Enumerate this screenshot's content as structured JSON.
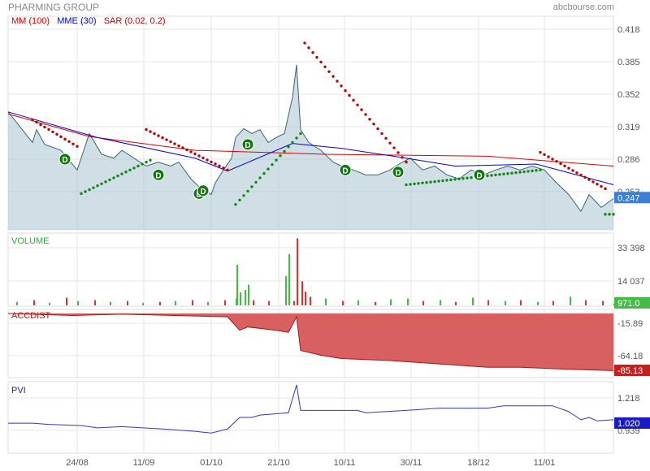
{
  "header": {
    "title": "PHARMING GROUP",
    "source": "abcbourse.com"
  },
  "legend": {
    "mm": "MM (100)",
    "mme": "MME (30)",
    "sar": "SAR (0.02, 0.2)"
  },
  "colors": {
    "price_fill": "#a9c4cf",
    "price_line": "#3b6474",
    "mm": "#e00000",
    "mme": "#0000e0",
    "sar": "#c00000",
    "sar_up": "#118811",
    "volume_up": "#44bb44",
    "volume_down": "#e03030",
    "accdist": "#d96060",
    "pvi": "#3333cc"
  },
  "chart_data": [
    {
      "type": "area",
      "name": "price",
      "title": "PHARMING GROUP",
      "ylim": [
        0.22,
        0.42
      ],
      "y_ticks": [
        "0.418",
        "0.385",
        "0.352",
        "0.319",
        "0.286",
        "0.253"
      ],
      "last_value": "0.247",
      "x_ticks": [
        "24/08",
        "11/09",
        "01/10",
        "21/10",
        "10/11",
        "30/11",
        "18/12",
        "11/01"
      ],
      "x": [
        0,
        6,
        7,
        9,
        13,
        17,
        20,
        23,
        26,
        28,
        31,
        34,
        37,
        40,
        42,
        45,
        47,
        50,
        51,
        53,
        55,
        56,
        58,
        60,
        62,
        64,
        66,
        68,
        70,
        71,
        72,
        74,
        77,
        80,
        82,
        85,
        88,
        91,
        94,
        97,
        99,
        102,
        105,
        108,
        111,
        114,
        117,
        120,
        123,
        126,
        129,
        132,
        135,
        138,
        141,
        143,
        146,
        149
      ],
      "values": [
        0.334,
        0.303,
        0.316,
        0.301,
        0.295,
        0.275,
        0.312,
        0.291,
        0.287,
        0.295,
        0.287,
        0.279,
        0.283,
        0.279,
        0.283,
        0.266,
        0.258,
        0.25,
        0.262,
        0.275,
        0.287,
        0.308,
        0.317,
        0.312,
        0.316,
        0.303,
        0.308,
        0.312,
        0.349,
        0.382,
        0.316,
        0.303,
        0.295,
        0.283,
        0.279,
        0.275,
        0.27,
        0.27,
        0.275,
        0.283,
        0.287,
        0.275,
        0.279,
        0.27,
        0.266,
        0.275,
        0.27,
        0.275,
        0.279,
        0.275,
        0.279,
        0.275,
        0.262,
        0.25,
        0.233,
        0.25,
        0.237,
        0.246
      ],
      "mm": {
        "x": [
          0,
          20,
          46,
          78,
          118,
          149
        ],
        "values": [
          0.332,
          0.309,
          0.295,
          0.291,
          0.289,
          0.279
        ]
      },
      "mme": {
        "x": [
          0,
          22,
          46,
          54,
          70,
          82,
          98,
          110,
          130,
          149
        ],
        "values": [
          0.334,
          0.308,
          0.287,
          0.274,
          0.302,
          0.297,
          0.287,
          0.279,
          0.281,
          0.26
        ]
      },
      "sar": [
        {
          "x": [
            6,
            17
          ],
          "values": [
            0.326,
            0.299
          ],
          "pos": "above"
        },
        {
          "x": [
            18,
            35
          ],
          "values": [
            0.251,
            0.285
          ],
          "pos": "below"
        },
        {
          "x": [
            34,
            54
          ],
          "values": [
            0.316,
            0.275
          ],
          "pos": "above"
        },
        {
          "x": [
            56,
            72
          ],
          "values": [
            0.24,
            0.312
          ],
          "pos": "below"
        },
        {
          "x": [
            73,
            98
          ],
          "values": [
            0.404,
            0.283
          ],
          "pos": "above"
        },
        {
          "x": [
            98,
            131
          ],
          "values": [
            0.26,
            0.275
          ],
          "pos": "below"
        },
        {
          "x": [
            131,
            147
          ],
          "values": [
            0.293,
            0.256
          ],
          "pos": "above"
        },
        {
          "x": [
            147,
            149
          ],
          "values": [
            0.23,
            0.23
          ],
          "pos": "below"
        }
      ],
      "dividends": {
        "label": "D",
        "x": [
          14,
          37,
          47,
          48,
          59,
          83,
          96,
          116
        ],
        "values": [
          0.286,
          0.27,
          0.251,
          0.254,
          0.301,
          0.275,
          0.273,
          0.27
        ]
      }
    },
    {
      "type": "bar",
      "name": "volume",
      "title": "VOLUME",
      "y_ticks": [
        "33 398",
        "14 037"
      ],
      "last_value": "971.0",
      "x": [
        2,
        6,
        10,
        14,
        17,
        21,
        25,
        29,
        33,
        37,
        41,
        45,
        49,
        53,
        56,
        56,
        57,
        58,
        59,
        60,
        64,
        68,
        69,
        70,
        71,
        72,
        73,
        74,
        78,
        82,
        86,
        90,
        94,
        98,
        102,
        106,
        110,
        114,
        118,
        122,
        126,
        130,
        134,
        138,
        142,
        146,
        149
      ],
      "values": [
        2000,
        3000,
        1500,
        4500,
        2500,
        3000,
        2000,
        2500,
        1500,
        2000,
        2500,
        3000,
        2000,
        3000,
        4000,
        23600,
        7500,
        9000,
        12000,
        3000,
        2500,
        17000,
        29700,
        2500,
        39000,
        14000,
        8000,
        5000,
        4000,
        2500,
        3000,
        2000,
        3500,
        4000,
        2500,
        3000,
        2000,
        4500,
        3000,
        2500,
        3000,
        2000,
        2500,
        5000,
        3000,
        2500,
        971
      ],
      "dir": [
        "u",
        "d",
        "u",
        "d",
        "u",
        "d",
        "u",
        "d",
        "u",
        "d",
        "u",
        "d",
        "u",
        "d",
        "u",
        "u",
        "u",
        "u",
        "u",
        "d",
        "d",
        "u",
        "u",
        "d",
        "d",
        "d",
        "d",
        "d",
        "u",
        "d",
        "u",
        "d",
        "u",
        "u",
        "d",
        "u",
        "d",
        "u",
        "d",
        "u",
        "d",
        "u",
        "d",
        "u",
        "d",
        "d",
        "u"
      ]
    },
    {
      "type": "area",
      "name": "accdist",
      "title": "ACCDIST",
      "y_ticks": [
        "-15.89",
        "-64.18"
      ],
      "last_value": "-85.13",
      "x": [
        0,
        16,
        28,
        54,
        57,
        59,
        66,
        69,
        71,
        72,
        77,
        82,
        94,
        106,
        118,
        126,
        138,
        149
      ],
      "values": [
        0,
        -3,
        -1,
        -5,
        -25,
        -20,
        -25,
        -28,
        -5,
        -55,
        -62,
        -67,
        -70,
        -75,
        -80,
        -80,
        -83,
        -85
      ]
    },
    {
      "type": "line",
      "name": "pvi",
      "title": "PVI",
      "y_ticks": [
        "1.218",
        "0.939"
      ],
      "last_value": "1.020",
      "x": [
        0,
        6,
        10,
        18,
        22,
        28,
        38,
        46,
        50,
        54,
        57,
        60,
        62,
        69,
        71,
        72,
        86,
        88,
        98,
        106,
        118,
        122,
        128,
        134,
        138,
        141,
        143,
        145,
        149
      ],
      "values": [
        1.0,
        1.0,
        0.99,
        0.98,
        0.96,
        0.97,
        0.95,
        0.93,
        0.915,
        0.95,
        1.05,
        1.05,
        1.07,
        1.09,
        1.33,
        1.11,
        1.11,
        1.09,
        1.11,
        1.13,
        1.13,
        1.15,
        1.15,
        1.15,
        1.1,
        1.03,
        1.05,
        1.02,
        1.03
      ]
    }
  ]
}
